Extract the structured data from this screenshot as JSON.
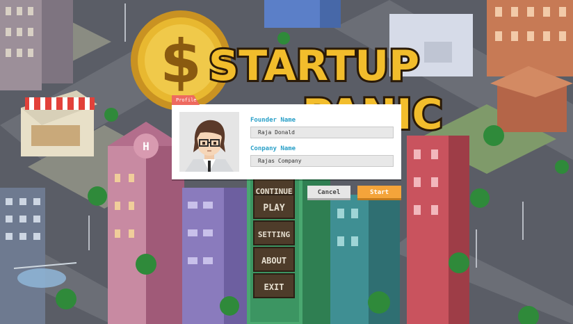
{
  "game": {
    "title_line1": "STARTUP",
    "title_line2": "PANIC",
    "coin_symbol": "$"
  },
  "menu": {
    "items": [
      "CONTINUE",
      "PLAY",
      "SETTING",
      "ABOUT",
      "EXIT"
    ]
  },
  "map_labels": {
    "helipad": "H"
  },
  "dialog": {
    "tab_label": "Profile",
    "founder_label": "Founder Name",
    "founder_value": "Raja Donald",
    "company_label": "Conpany Name",
    "company_value": "Rajas Company"
  },
  "buttons": {
    "cancel": "Cancel",
    "start": "Start"
  },
  "colors": {
    "accent_label": "#2aa0c8",
    "tab": "#ee6a5f",
    "start": "#f4a43a",
    "cancel": "#e6e6e6",
    "coin": "#e8b830"
  }
}
